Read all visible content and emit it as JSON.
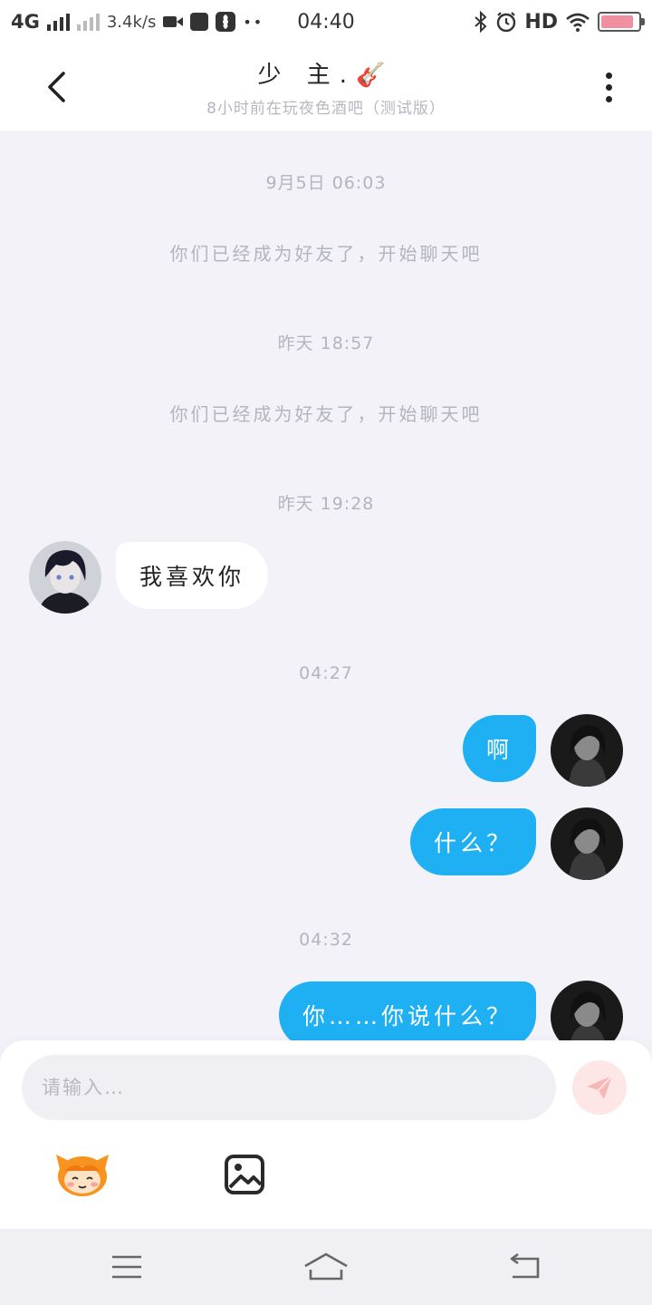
{
  "status_bar": {
    "network": "4G",
    "speed": "3.4k/s",
    "time": "04:40",
    "hd": "HD",
    "icons": [
      "signal-icon",
      "video-icon",
      "fan-icon",
      "bluetooth-icon",
      "alarm-icon",
      "wifi-icon",
      "battery-icon"
    ]
  },
  "header": {
    "title": "少 主.🎸",
    "subtitle": "8小时前在玩夜色酒吧（测试版）"
  },
  "messages": {
    "stamp1": "9月5日 06:03",
    "system1": "你们已经成为好友了，开始聊天吧",
    "stamp2": "昨天 18:57",
    "system2": "你们已经成为好友了，开始聊天吧",
    "stamp3": "昨天 19:28",
    "incoming1": "我喜欢你",
    "stamp4": "04:27",
    "outgoing1": "啊",
    "outgoing2": "什么？",
    "stamp5": "04:32",
    "outgoing3": "你……你说什么？"
  },
  "composer": {
    "placeholder": "请输入…",
    "value": ""
  },
  "colors": {
    "outgoing_bubble": "#1eb0f3",
    "incoming_bubble": "#ffffff",
    "background": "#f2f2f8",
    "send_button": "#fde6e6"
  }
}
